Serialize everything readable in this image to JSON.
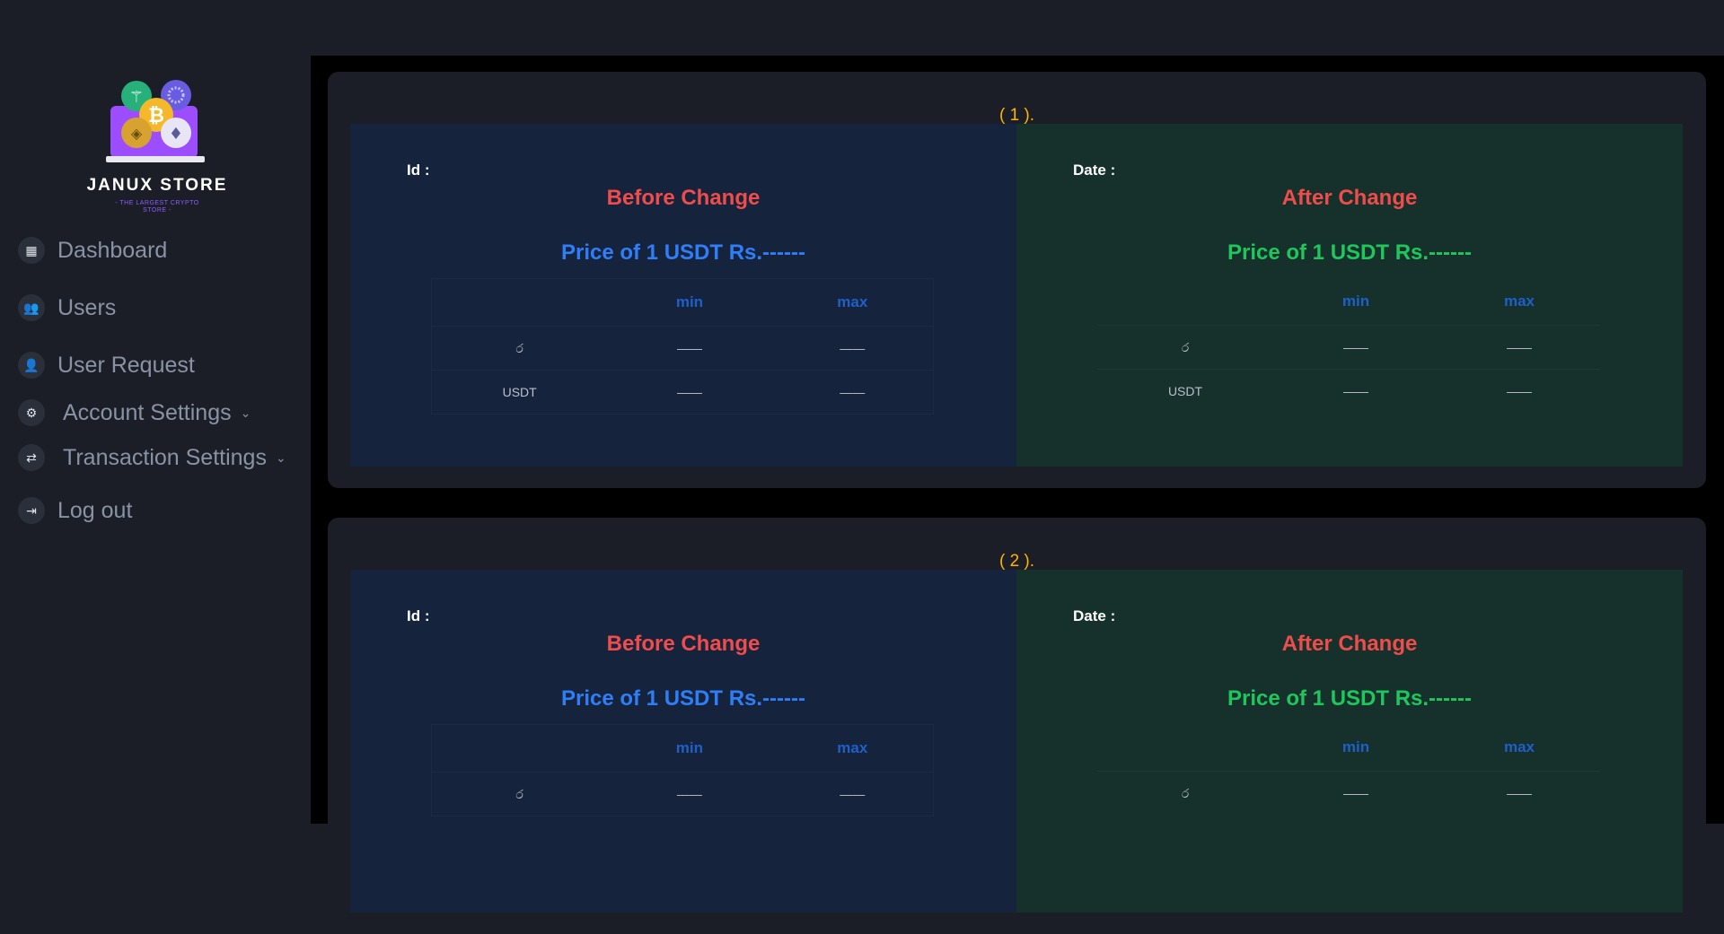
{
  "brand": {
    "name": "JANUX STORE",
    "tagline": "- THE LARGEST CRYPTO STORE -"
  },
  "nav": [
    {
      "label": "Dashboard",
      "icon": "dashboard-icon"
    },
    {
      "label": "Users",
      "icon": "users-icon"
    },
    {
      "label": "User Request",
      "icon": "user-add-icon"
    },
    {
      "label": "Account Settings",
      "icon": "gear-icon",
      "chevron": "⌄"
    },
    {
      "label": "Transaction Settings",
      "icon": "swap-icon",
      "chevron": "⌄"
    },
    {
      "label": "Log out",
      "icon": "logout-icon"
    }
  ],
  "cards": [
    {
      "index": "( 1 ).",
      "before": {
        "label": "Id :",
        "title": "Before Change",
        "price": "Price of 1 USDT Rs.------",
        "columns": [
          "",
          "min",
          "max"
        ],
        "rows": [
          [
            "ර",
            "——",
            "——"
          ],
          [
            "USDT",
            "——",
            "——"
          ]
        ]
      },
      "after": {
        "label": "Date :",
        "title": "After Change",
        "price": "Price of 1 USDT Rs.------",
        "columns": [
          "",
          "min",
          "max"
        ],
        "rows": [
          [
            "ර",
            "——",
            "——"
          ],
          [
            "USDT",
            "——",
            "——"
          ]
        ]
      }
    },
    {
      "index": "( 2 ).",
      "before": {
        "label": "Id :",
        "title": "Before Change",
        "price": "Price of 1 USDT Rs.------",
        "columns": [
          "",
          "min",
          "max"
        ],
        "rows": [
          [
            "ර",
            "——",
            "——"
          ]
        ]
      },
      "after": {
        "label": "Date :",
        "title": "After Change",
        "price": "Price of 1 USDT Rs.------",
        "columns": [
          "",
          "min",
          "max"
        ],
        "rows": [
          [
            "ර",
            "——",
            "——"
          ]
        ]
      }
    }
  ],
  "colors": {
    "accent_index": "#ffb400",
    "title_red": "#ef4c4c",
    "price_blue": "#2f7ef7",
    "price_green": "#1fc65c",
    "header_blue": "#1f5fc8"
  }
}
